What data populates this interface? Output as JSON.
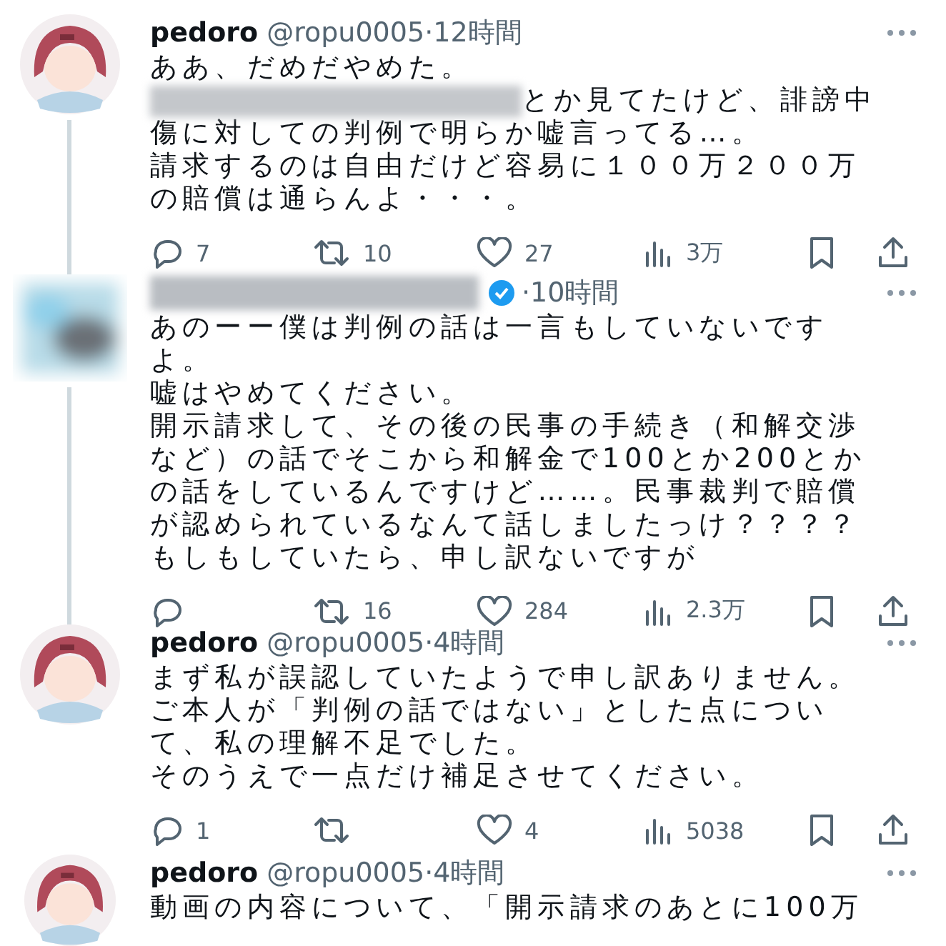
{
  "tweets": [
    {
      "avatar": {
        "kind": "character"
      },
      "author": {
        "redacted": false,
        "name": "pedoro",
        "handle": "@ropu0005",
        "verified": false
      },
      "time": "·12時間",
      "thread_below": true,
      "lines": [
        {
          "kind": "text",
          "text": "ああ、だめだやめた。"
        },
        {
          "kind": "redacted_text",
          "text": "とか見てたけど、誹謗中"
        },
        {
          "kind": "text",
          "text": "傷に対しての判例で明らか嘘言ってる…。"
        },
        {
          "kind": "text",
          "text": "請求するのは自由だけど容易に１００万２００万"
        },
        {
          "kind": "text",
          "text": "の賠償は通らんよ・・・。"
        }
      ],
      "replies": "7",
      "retweets": "10",
      "likes": "27",
      "views": "3万"
    },
    {
      "avatar": {
        "kind": "blurred"
      },
      "author": {
        "redacted": true,
        "verified": true
      },
      "time": "·10時間",
      "thread_below": true,
      "lines": [
        {
          "kind": "text",
          "text": "あのーー僕は判例の話は一言もしていないです"
        },
        {
          "kind": "text",
          "text": "よ。"
        },
        {
          "kind": "text",
          "text": "嘘はやめてください。"
        },
        {
          "kind": "text",
          "text": "開示請求して、その後の民事の手続き（和解交渉"
        },
        {
          "kind": "text",
          "text": "など）の話でそこから和解金で100とか200とか"
        },
        {
          "kind": "text",
          "text": "の話をしているんですけど……。民事裁判で賠償"
        },
        {
          "kind": "text",
          "text": "が認められているなんて話しましたっけ？？？？"
        },
        {
          "kind": "text",
          "text": "もしもしていたら、申し訳ないですが"
        }
      ],
      "retweets": "16",
      "likes": "284",
      "views": "2.3万"
    },
    {
      "avatar": {
        "kind": "character"
      },
      "author": {
        "redacted": false,
        "name": "pedoro",
        "handle": "@ropu0005",
        "verified": false
      },
      "time": "·4時間",
      "thread_below": false,
      "lines": [
        {
          "kind": "text",
          "text": "まず私が誤認していたようで申し訳ありません。"
        },
        {
          "kind": "text",
          "text": "ご本人が「判例の話ではない」とした点につい"
        },
        {
          "kind": "text",
          "text": "て、私の理解不足でした。"
        },
        {
          "kind": "text",
          "text": "そのうえで一点だけ補足させてください。"
        }
      ],
      "replies": "1",
      "likes": "4",
      "views": "5038"
    },
    {
      "avatar": {
        "kind": "character"
      },
      "author": {
        "redacted": false,
        "name": "pedoro",
        "handle": "@ropu0005",
        "verified": false
      },
      "time": "·4時間",
      "thread_below": false,
      "lines": [
        {
          "kind": "text",
          "text": "動画の内容について、「開示請求のあとに100万"
        }
      ]
    }
  ]
}
